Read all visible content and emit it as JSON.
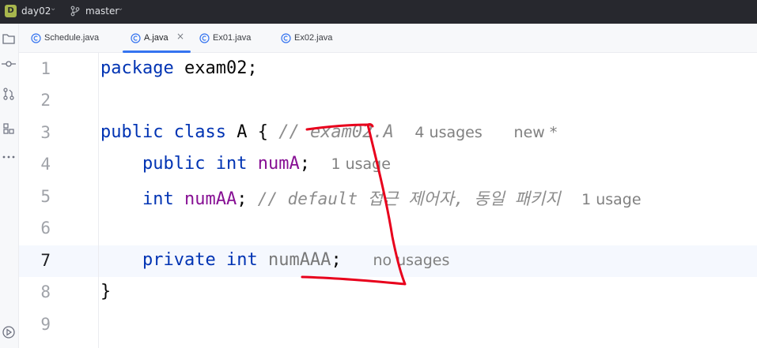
{
  "titlebar": {
    "project_initial": "D",
    "project_name": "day02",
    "branch_name": "master"
  },
  "tabs": [
    {
      "label": "Schedule.java",
      "active": false
    },
    {
      "label": "A.java",
      "active": true,
      "close": "×"
    },
    {
      "label": "Ex01.java",
      "active": false
    },
    {
      "label": "Ex02.java",
      "active": false
    }
  ],
  "editor": {
    "current_line": 7,
    "line_numbers": [
      "1",
      "2",
      "3",
      "4",
      "5",
      "6",
      "7",
      "8",
      "9"
    ],
    "lines": {
      "l1": {
        "kw": "package",
        "rest": " exam02;"
      },
      "l3": {
        "kw1": "public",
        "kw2": "class",
        "rest": " A { ",
        "comment": "// exam02.A",
        "hint_usages": "4 usages",
        "hint_new": "new *"
      },
      "l4": {
        "kw1": "public",
        "kw2": "int",
        "field": "numA",
        "semi": ";",
        "hint": "1 usage"
      },
      "l5": {
        "kw": "int",
        "field": "numAA",
        "semi": "; ",
        "comment": "// default 접근 제어자, 동일 패키지",
        "hint": "1 usage"
      },
      "l7": {
        "kw1": "private",
        "kw2": "int",
        "field": "numAAA",
        "semi": ";",
        "hint": "no usages"
      },
      "l8": {
        "brace": "}"
      }
    }
  },
  "colors": {
    "accent": "#3574f0",
    "keyword": "#0033b3",
    "field": "#871094",
    "annotation": "#e8001c"
  }
}
